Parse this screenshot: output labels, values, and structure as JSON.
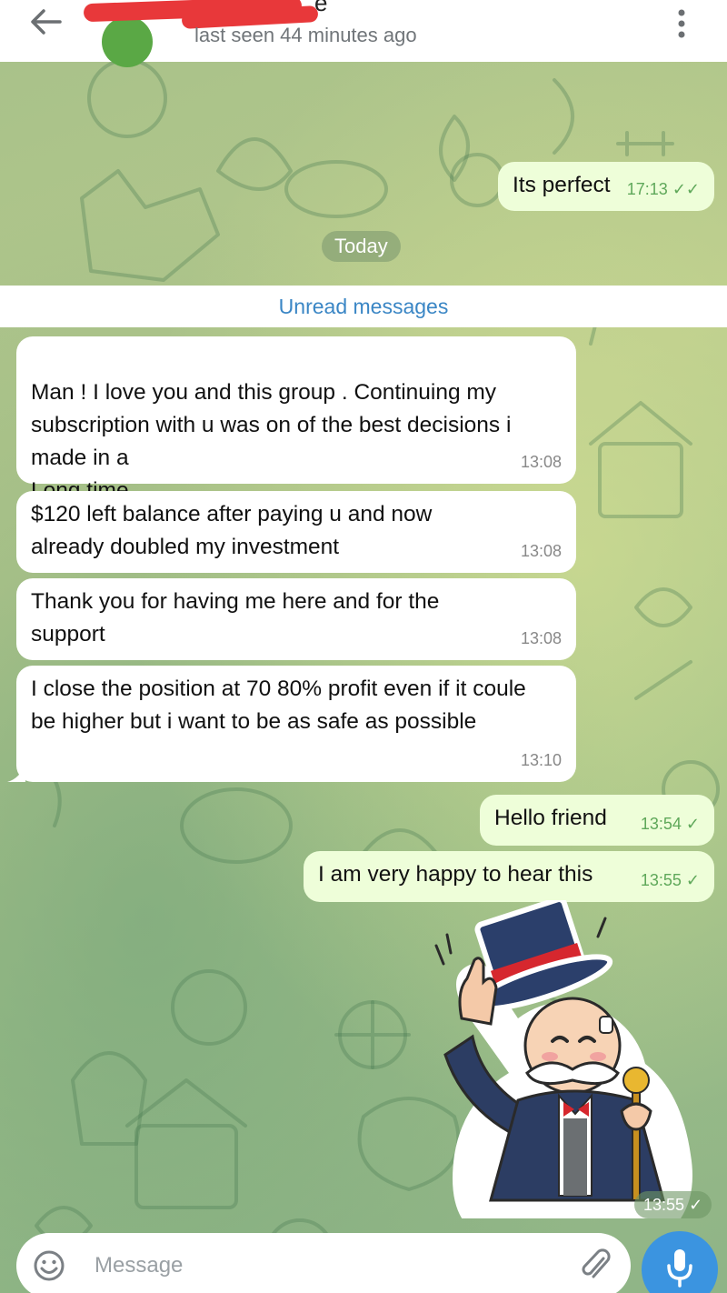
{
  "header": {
    "name_tail": "e",
    "last_seen": "last seen 44 minutes ago",
    "back_icon": "arrow-left",
    "menu_icon": "vertical-dots"
  },
  "messages": {
    "earlier_out": {
      "text": "Its perfect",
      "time": "17:13"
    },
    "date_label": "Today",
    "unread_label": "Unread messages",
    "incoming": [
      {
        "text": "Man ! I love you and this group . Continuing my subscription with u was on of the best decisions i made in a\nLong time",
        "time": "13:08"
      },
      {
        "text": "$120 left balance after paying u and now already doubled my investment",
        "time": "13:08"
      },
      {
        "text": "Thank you for having me here and for the support",
        "time": "13:08"
      },
      {
        "text": "I  close the position at 70 80% profit even if it coule be higher but i want to be as safe as possible",
        "time": "13:10"
      }
    ],
    "outgoing": [
      {
        "text": "Hello friend",
        "time": "13:54"
      },
      {
        "text": "I am very happy to hear this",
        "time": "13:55"
      }
    ],
    "sticker": {
      "name": "monopoly-man-tipping-hat",
      "time": "13:55"
    }
  },
  "composer": {
    "placeholder": "Message",
    "emoji_icon": "smiley",
    "attach_icon": "paperclip",
    "mic_icon": "microphone"
  },
  "colors": {
    "incoming_bubble": "#ffffff",
    "outgoing_bubble": "#eefed9",
    "accent_blue": "#3b94e0",
    "unread_text": "#3a86c5",
    "check_green": "#5fa85a"
  }
}
